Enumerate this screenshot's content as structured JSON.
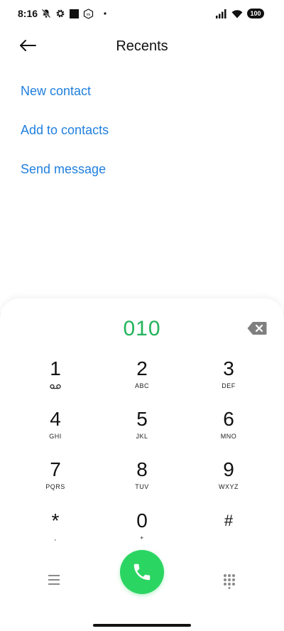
{
  "status_bar": {
    "time": "8:16",
    "icons_left": [
      "bell-off-icon",
      "gear-icon",
      "square-icon",
      "mi-icon",
      "dot-icon"
    ],
    "icons_right": [
      "signal-icon",
      "wifi-icon"
    ],
    "battery": "100"
  },
  "header": {
    "title": "Recents",
    "back_icon": "arrow-left-icon"
  },
  "actions": {
    "new_contact": "New contact",
    "add_to_contacts": "Add to contacts",
    "send_message": "Send message"
  },
  "dialer": {
    "number": "010",
    "keys": [
      {
        "digit": "1",
        "letters": ""
      },
      {
        "digit": "2",
        "letters": "ABC"
      },
      {
        "digit": "3",
        "letters": "DEF"
      },
      {
        "digit": "4",
        "letters": "GHI"
      },
      {
        "digit": "5",
        "letters": "JKL"
      },
      {
        "digit": "6",
        "letters": "MNO"
      },
      {
        "digit": "7",
        "letters": "PQRS"
      },
      {
        "digit": "8",
        "letters": "TUV"
      },
      {
        "digit": "9",
        "letters": "WXYZ"
      },
      {
        "digit": "*",
        "letters": ","
      },
      {
        "digit": "0",
        "letters": "+"
      },
      {
        "digit": "#",
        "letters": ""
      }
    ]
  },
  "colors": {
    "accent_link": "#1f7fde",
    "number_green": "#22b45a",
    "call_green": "#2bd562"
  }
}
